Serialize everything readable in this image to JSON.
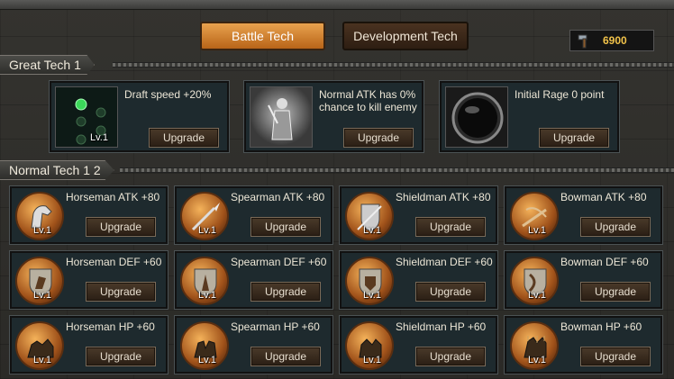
{
  "tabs": {
    "battle": "Battle Tech",
    "development": "Development Tech"
  },
  "resource": {
    "value": "6900",
    "icon": "hammer-icon"
  },
  "sections": {
    "great": "Great Tech 1",
    "normal": "Normal Tech 1 2"
  },
  "great_tech": [
    {
      "text": "Draft speed +20%",
      "level": "Lv.1",
      "button": "Upgrade"
    },
    {
      "text": "Normal ATK has 0% chance to kill enemy",
      "button": "Upgrade"
    },
    {
      "text": "Initial Rage 0 point",
      "button": "Upgrade"
    }
  ],
  "normal_tech": [
    {
      "name": "Horseman ATK +80",
      "level": "Lv.1",
      "button": "Upgrade"
    },
    {
      "name": "Spearman ATK +80",
      "level": "Lv.1",
      "button": "Upgrade"
    },
    {
      "name": "Shieldman ATK +80",
      "level": "Lv.1",
      "button": "Upgrade"
    },
    {
      "name": "Bowman ATK +80",
      "level": "Lv.1",
      "button": "Upgrade"
    },
    {
      "name": "Horseman DEF +60",
      "level": "Lv.1",
      "button": "Upgrade"
    },
    {
      "name": "Spearman DEF +60",
      "level": "Lv.1",
      "button": "Upgrade"
    },
    {
      "name": "Shieldman DEF +60",
      "level": "Lv.1",
      "button": "Upgrade"
    },
    {
      "name": "Bowman DEF +60",
      "level": "Lv.1",
      "button": "Upgrade"
    },
    {
      "name": "Horseman HP +60",
      "level": "Lv.1",
      "button": "Upgrade"
    },
    {
      "name": "Spearman HP +60",
      "level": "Lv.1",
      "button": "Upgrade"
    },
    {
      "name": "Shieldman HP +60",
      "level": "Lv.1",
      "button": "Upgrade"
    },
    {
      "name": "Bowman HP +60",
      "level": "Lv.1",
      "button": "Upgrade"
    }
  ]
}
